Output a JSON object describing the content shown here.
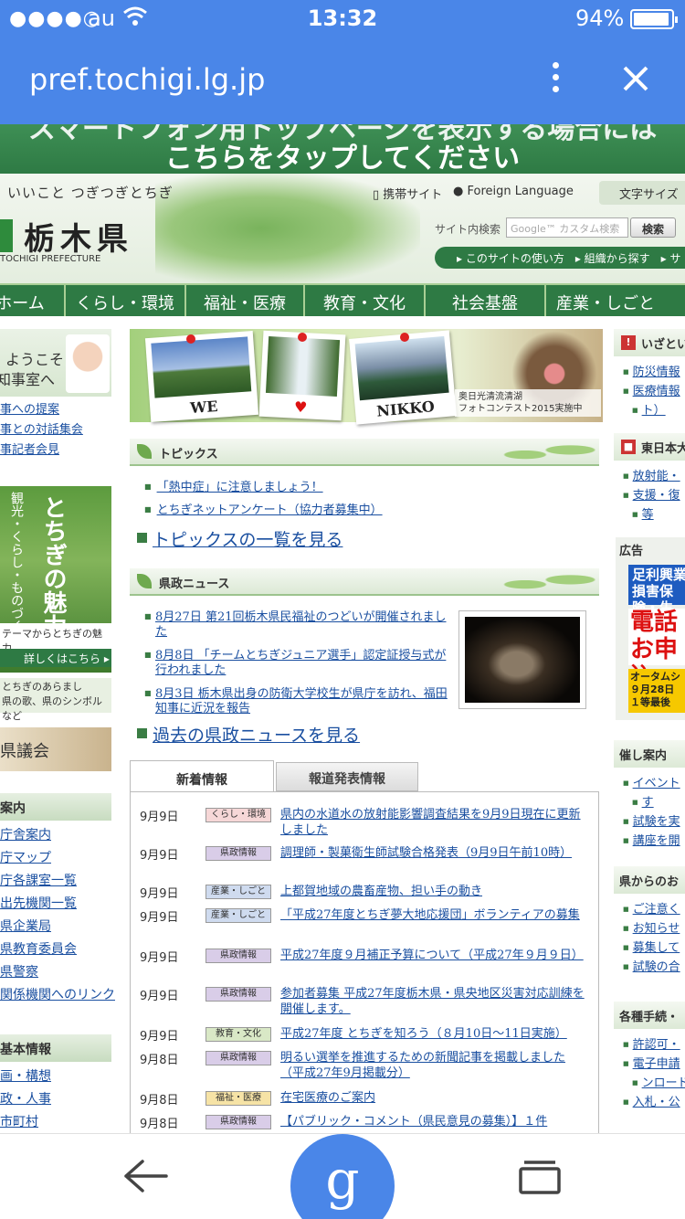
{
  "status": {
    "signal": "●●●●○",
    "carrier": "au",
    "time": "13:32",
    "battery": "94%"
  },
  "browser": {
    "url": "pref.tochigi.lg.jp"
  },
  "banner": {
    "line1": "スマートフォン用トップページを表示する場合には",
    "line2": "こちらをタップしてください"
  },
  "header": {
    "slogan": "いいこと つぎつぎとちぎ",
    "logo_jp": "栃木県",
    "logo_en": "TOCHIGI PREFECTURE",
    "mobile": "携帯サイト",
    "foreign": "Foreign Language",
    "fontsize": "文字サイズ",
    "search_label": "サイト内検索",
    "search_placeholder": "Google™ カスタム検索",
    "search_button": "検索",
    "subnav": "▸ このサイトの使い方　▸ 組織から探す　▸ サ"
  },
  "nav": [
    "ホーム",
    "くらし・環境",
    "福祉・医療",
    "教育・文化",
    "社会基盤",
    "産業・しごと"
  ],
  "left": {
    "gov_line1": "ようこそ",
    "gov_line2": "知事室へ",
    "links1": [
      "事への提案",
      "事との対話集会",
      "事記者会見"
    ],
    "promo_big": "とちぎの魅力",
    "promo_small": "観光・くらし・ものづくり",
    "promo_caption": "テーマからとちぎの魅力",
    "promo_more": "詳しくはこちら ▸",
    "info": "とちぎのあらまし\n県の歌、県のシンボルなど",
    "assembly": "県議会",
    "sec_guide": "案内",
    "links2": [
      "庁舎案内",
      "庁マップ",
      "庁各課室一覧",
      "出先機関一覧",
      "県企業局",
      "県教育委員会",
      "県警察",
      "関係機関へのリンク"
    ],
    "sec_basic": "基本情報",
    "links3": [
      "画・構想",
      "政・人事",
      "市町村"
    ]
  },
  "hero": {
    "pol1": "WE",
    "pol3": "NIKKO",
    "caption": "奥日光清流清湖\nフォトコンテスト2015実施中"
  },
  "topics": {
    "title": "トピックス",
    "items": [
      "「熱中症」に注意しましょう！",
      "とちぎネットアンケート（協力者募集中）"
    ],
    "see_all": "トピックスの一覧を見る"
  },
  "news": {
    "title": "県政ニュース",
    "items": [
      "8月27日 第21回栃木県民福祉のつどいが開催されました",
      "8月8日 「チームとちぎジュニア選手」認定証授与式が行われました",
      "8月3日 栃木県出身の防衛大学校生が県庁を訪れ、福田知事に近況を報告"
    ],
    "see_all": "過去の県政ニュースを見る"
  },
  "tabs": {
    "new": "新着情報",
    "press": "報道発表情報"
  },
  "updates": [
    {
      "date": "9月9日",
      "cat": "くらし・環境",
      "cls": "cat-kurashi",
      "text": "県内の水道水の放射能影響調査結果を9月9日現在に更新しました"
    },
    {
      "date": "9月9日",
      "cat": "県政情報",
      "cls": "cat-kensei",
      "text": "調理師・製菓衛生師試験合格発表（9月9日午前10時）"
    },
    {
      "date": "9月9日",
      "cat": "産業・しごと",
      "cls": "cat-sangyo",
      "text": "上都賀地域の農畜産物、担い手の動き"
    },
    {
      "date": "9月9日",
      "cat": "産業・しごと",
      "cls": "cat-sangyo",
      "text": "「平成27年度とちぎ夢大地応援団」ボランティアの募集"
    },
    {
      "date": "9月9日",
      "cat": "県政情報",
      "cls": "cat-kensei",
      "text": "平成27年度９月補正予算について（平成27年９月９日）"
    },
    {
      "date": "9月9日",
      "cat": "県政情報",
      "cls": "cat-kensei",
      "text": "参加者募集 平成27年度栃木県・県央地区災害対応訓練を開催します。"
    },
    {
      "date": "9月9日",
      "cat": "教育・文化",
      "cls": "cat-kyoiku",
      "text": "平成27年度 とちぎを知ろう（８月10日～11日実施）"
    },
    {
      "date": "9月8日",
      "cat": "県政情報",
      "cls": "cat-kensei",
      "text": "明るい選挙を推進するための新聞記事を掲載しました（平成27年9月掲載分）"
    },
    {
      "date": "9月8日",
      "cat": "福祉・医療",
      "cls": "cat-fukushi",
      "text": "在宅医療のご案内"
    },
    {
      "date": "9月8日",
      "cat": "県政情報",
      "cls": "cat-kensei",
      "text": "【パブリック・コメント（県民意見の募集）】１件"
    }
  ],
  "right": {
    "sec1": "いざとい",
    "links1": [
      "防災情報",
      "医療情報",
      "ト）"
    ],
    "sec2": "東日本大",
    "links2": [
      "放射能・",
      "支援・復",
      "等"
    ],
    "ad_label": "広告",
    "ad1": "足利興業\n損害保険・生",
    "ad2": "電話\nお申込",
    "ad3": "オータムシ\n９月28日\n１等最後",
    "sec3": "催し案内",
    "links3": [
      "イベント",
      "す",
      "試験を実",
      "講座を開"
    ],
    "sec4": "県からのお",
    "links4": [
      "ご注意く",
      "お知らせ",
      "募集して",
      "試験の合"
    ],
    "sec5": "各種手続・",
    "links5": [
      "許認可・",
      "電子申請",
      "ンロード",
      "入札・公"
    ]
  },
  "colors": {
    "chrome": "#4a86e8",
    "green": "#2e7a44",
    "link": "#1a4fa0"
  }
}
